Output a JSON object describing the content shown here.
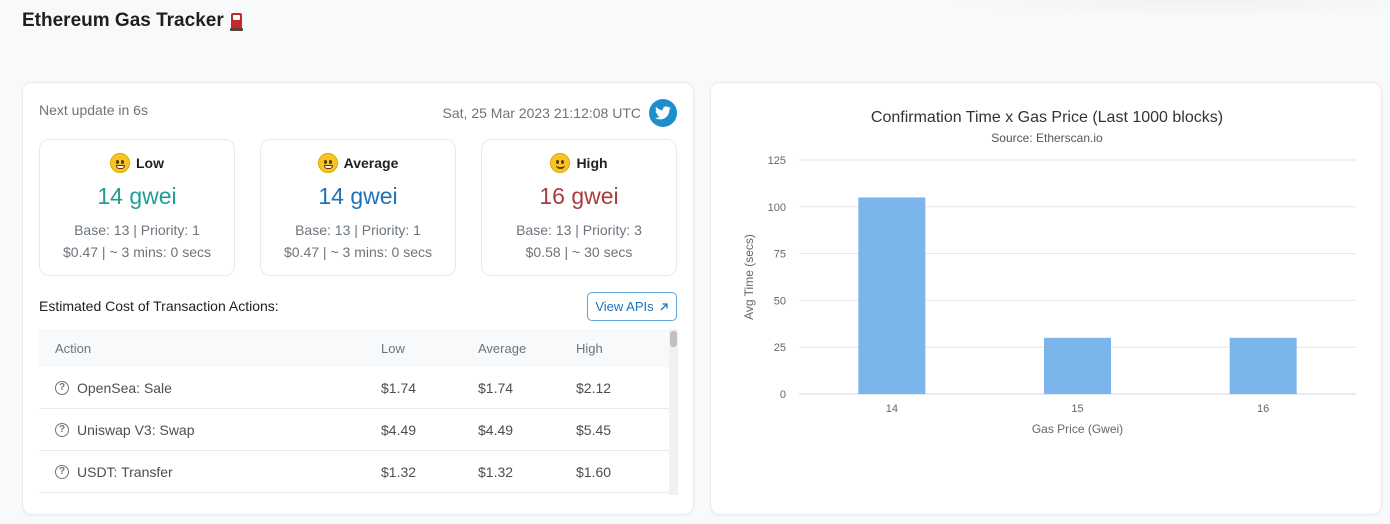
{
  "header": {
    "title": "Ethereum Gas Tracker",
    "icon": "fuel-pump-icon"
  },
  "status": {
    "next_update": "Next update in 6s",
    "timestamp": "Sat, 25 Mar 2023 21:12:08 UTC",
    "share_icon": "twitter-icon"
  },
  "tiers": [
    {
      "label": "Low",
      "emoji": "grinning-face",
      "gwei": "14 gwei",
      "color": "#219d96",
      "base": "Base: 13 | Priority: 1",
      "cost": "$0.47 | ~ 3 mins: 0 secs"
    },
    {
      "label": "Average",
      "emoji": "smiling-face",
      "gwei": "14 gwei",
      "color": "#1e73b8",
      "base": "Base: 13 | Priority: 1",
      "cost": "$0.47 | ~ 3 mins: 0 secs"
    },
    {
      "label": "High",
      "emoji": "slightly-smiling-face",
      "gwei": "16 gwei",
      "color": "#a93c3c",
      "base": "Base: 13 | Priority: 3",
      "cost": "$0.58 | ~ 30 secs"
    }
  ],
  "estimates": {
    "title": "Estimated Cost of Transaction Actions:",
    "view_apis_label": "View APIs",
    "columns": [
      "Action",
      "Low",
      "Average",
      "High"
    ],
    "rows": [
      {
        "action": "OpenSea: Sale",
        "low": "$1.74",
        "average": "$1.74",
        "high": "$2.12"
      },
      {
        "action": "Uniswap V3: Swap",
        "low": "$4.49",
        "average": "$4.49",
        "high": "$5.45"
      },
      {
        "action": "USDT: Transfer",
        "low": "$1.32",
        "average": "$1.32",
        "high": "$1.60"
      }
    ]
  },
  "chart_data": {
    "type": "bar",
    "title": "Confirmation Time x Gas Price (Last 1000 blocks)",
    "subtitle": "Source: Etherscan.io",
    "xlabel": "Gas Price (Gwei)",
    "ylabel": "Avg Time (secs)",
    "categories": [
      "14",
      "15",
      "16"
    ],
    "values": [
      105,
      30,
      30
    ],
    "ylim": [
      0,
      125
    ],
    "yticks": [
      0,
      25,
      50,
      75,
      100,
      125
    ],
    "grid": true,
    "bar_color": "#7cb5ec"
  }
}
